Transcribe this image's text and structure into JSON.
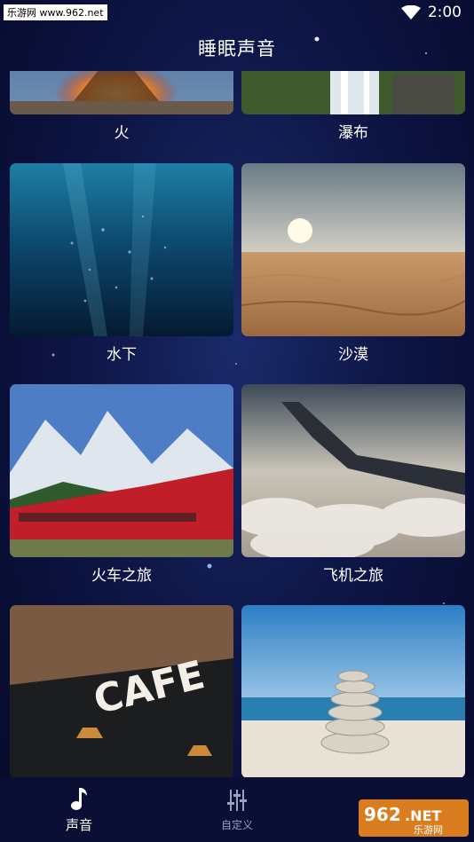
{
  "status_bar": {
    "watermark": "乐游网 www.962.net",
    "time": "2:00"
  },
  "header": {
    "title": "睡眠声音"
  },
  "sounds": [
    {
      "label": "火"
    },
    {
      "label": "瀑布"
    },
    {
      "label": "水下"
    },
    {
      "label": "沙漠"
    },
    {
      "label": "火车之旅"
    },
    {
      "label": "飞机之旅"
    },
    {
      "label": ""
    },
    {
      "label": ""
    }
  ],
  "bottom_nav": {
    "items": [
      {
        "label": "声音",
        "icon": "music-note-icon",
        "active": true
      },
      {
        "label": "自定义",
        "icon": "sliders-icon",
        "active": false
      }
    ]
  },
  "logo": {
    "text": "962",
    "suffix": ".NET",
    "sub": "乐游网"
  }
}
